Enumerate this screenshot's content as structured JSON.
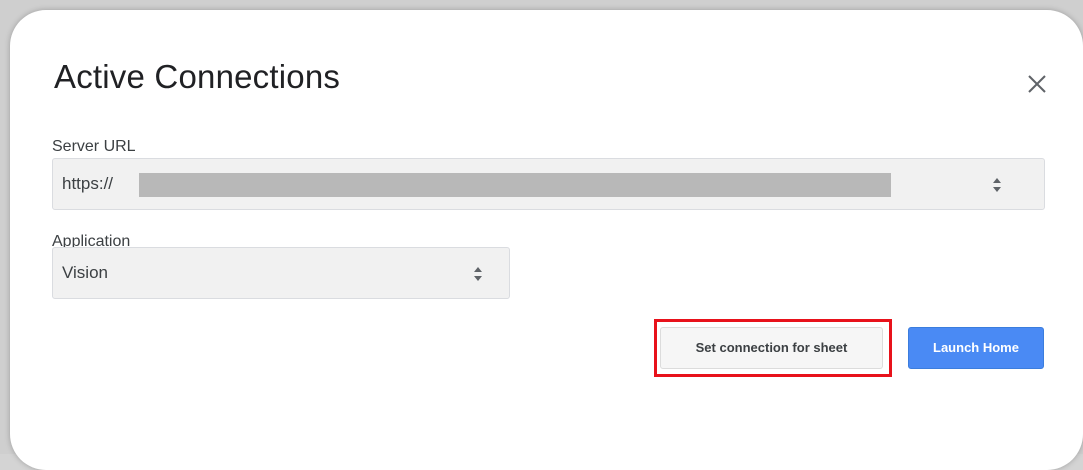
{
  "dialog": {
    "title": "Active Connections",
    "close_icon": "close-icon"
  },
  "server": {
    "label": "Server URL",
    "value_prefix": "https://",
    "redacted": true
  },
  "application": {
    "label": "Application",
    "value": "Vision"
  },
  "buttons": {
    "set_connection": "Set connection for sheet",
    "launch_home": "Launch Home"
  },
  "colors": {
    "primary": "#4a8af4",
    "highlight": "#e8121b",
    "field_bg": "#f1f1f1"
  }
}
